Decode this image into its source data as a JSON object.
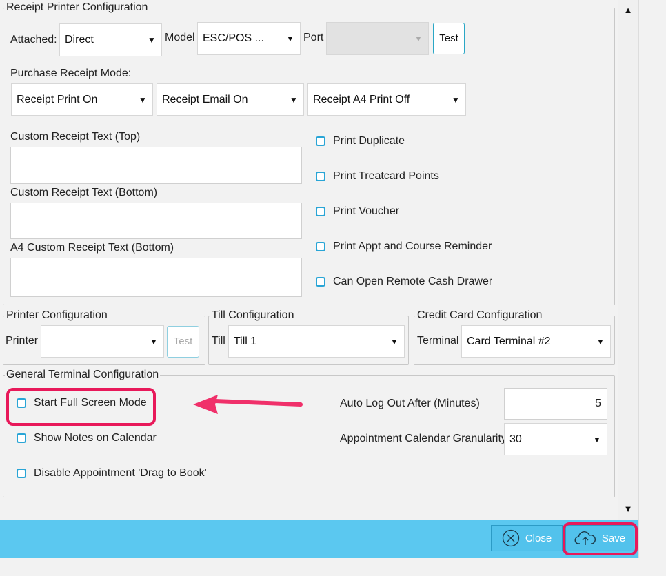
{
  "receipt_printer": {
    "legend": "Receipt Printer Configuration",
    "attached_label": "Attached:",
    "attached_value": "Direct",
    "model_label": "Model",
    "model_value": "ESC/POS ...",
    "port_label": "Port",
    "port_value": "",
    "test_label": "Test",
    "purchase_mode_label": "Purchase Receipt Mode:",
    "print_mode": "Receipt Print On",
    "email_mode": "Receipt Email On",
    "a4_mode": "Receipt A4 Print Off",
    "custom_top_label": "Custom Receipt Text (Top)",
    "custom_bottom_label": "Custom Receipt Text (Bottom)",
    "a4_custom_bottom_label": "A4 Custom Receipt Text (Bottom)",
    "checkboxes": [
      "Print Duplicate",
      "Print Treatcard Points",
      "Print Voucher",
      "Print Appt and Course Reminder",
      "Can Open Remote Cash Drawer"
    ]
  },
  "printer_config": {
    "legend": "Printer Configuration",
    "printer_label": "Printer",
    "printer_value": "",
    "test_label": "Test"
  },
  "till_config": {
    "legend": "Till Configuration",
    "till_label": "Till",
    "till_value": "Till 1"
  },
  "credit_card_config": {
    "legend": "Credit Card Configuration",
    "terminal_label": "Terminal",
    "terminal_value": "Card Terminal #2"
  },
  "general_terminal": {
    "legend": "General Terminal Configuration",
    "checkboxes": [
      "Start Full Screen Mode",
      "Show Notes on Calendar",
      "Disable Appointment 'Drag to Book'"
    ],
    "auto_logout_label": "Auto Log Out After (Minutes)",
    "auto_logout_value": "5",
    "granularity_label": "Appointment Calendar Granularity",
    "granularity_value": "30"
  },
  "footer": {
    "close_label": "Close",
    "save_label": "Save"
  },
  "annotation": {
    "highlight_color": "#e8195a",
    "arrow_color": "#f0306a"
  }
}
